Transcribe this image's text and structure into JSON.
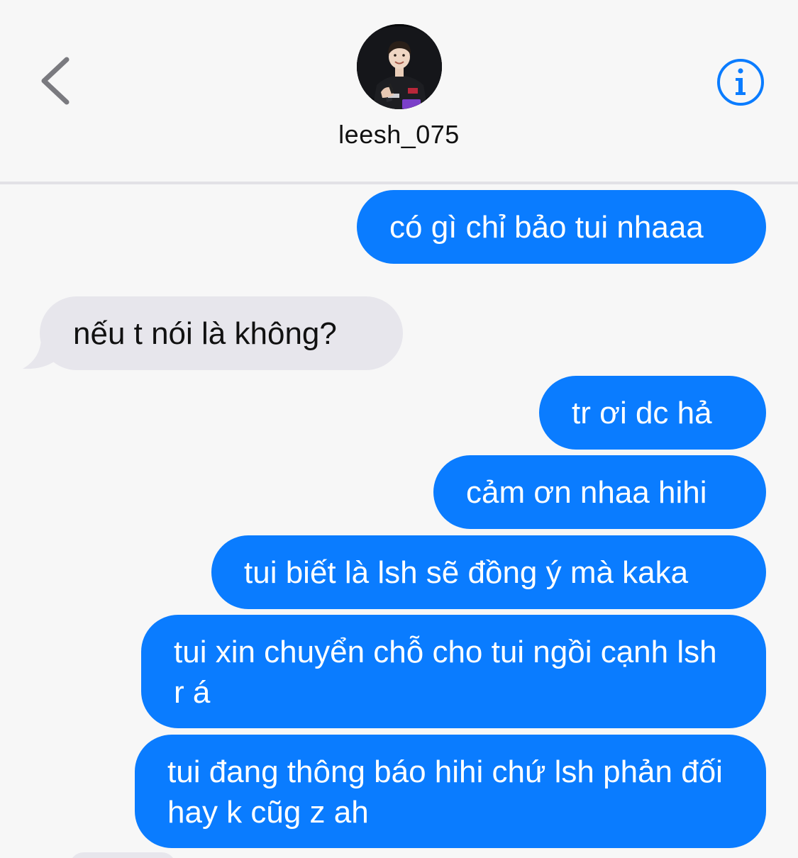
{
  "header": {
    "contact_name": "leesh_075",
    "back_icon": "chevron-left-icon",
    "info_icon": "info-circle-icon",
    "accent_color": "#0a7cff"
  },
  "messages": [
    {
      "direction": "sent",
      "text": "có gì chỉ bảo tui nhaaa"
    },
    {
      "direction": "received",
      "text": "nếu t nói là không?"
    },
    {
      "direction": "sent",
      "text": "tr ơi dc hả"
    },
    {
      "direction": "sent",
      "text": "cảm ơn nhaa hihi"
    },
    {
      "direction": "sent",
      "text": "tui biết là lsh sẽ đồng ý mà kaka"
    },
    {
      "direction": "sent",
      "text": "tui xin chuyển chỗ cho tui ngồi cạnh lsh r á"
    },
    {
      "direction": "sent",
      "text": "tui đang thông báo hihi chứ lsh phản đối hay k cũg z ah"
    }
  ],
  "colors": {
    "sent_bubble": "#0a7cff",
    "received_bubble": "#e7e6ec",
    "background": "#f7f7f7"
  }
}
